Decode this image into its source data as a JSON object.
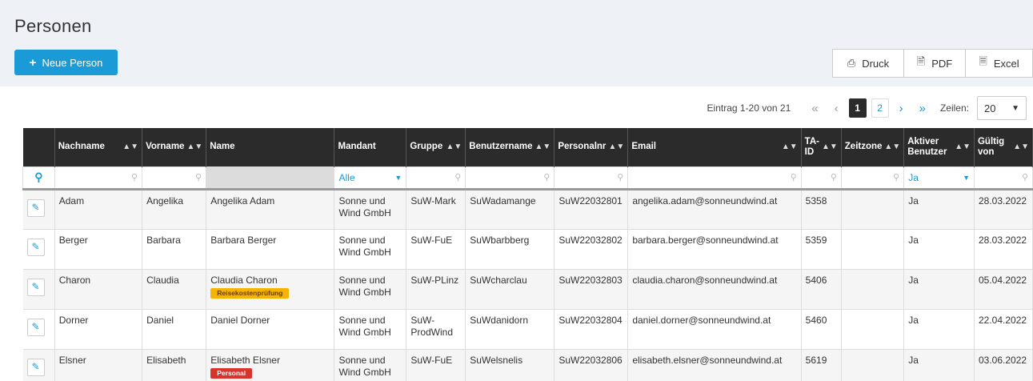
{
  "page": {
    "title": "Personen",
    "new_button": "Neue Person"
  },
  "export": {
    "druck": "Druck",
    "pdf": "PDF",
    "excel": "Excel"
  },
  "pager": {
    "info": "Eintrag 1-20 von 21",
    "first": "«",
    "prev": "‹",
    "page1": "1",
    "page2": "2",
    "next": "›",
    "last": "»",
    "rows_label": "Zeilen:",
    "rows_value": "20"
  },
  "columns": [
    "Nachname",
    "Vorname",
    "Name",
    "Mandant",
    "Gruppe",
    "Benutzername",
    "Personalnr",
    "Email",
    "TA-ID",
    "Zeitzone",
    "Aktiver Benutzer",
    "Gültig von"
  ],
  "filters": {
    "mandant": "Alle",
    "aktiv": "Ja"
  },
  "rows": [
    {
      "nachname": "Adam",
      "vorname": "Angelika",
      "name": "Angelika Adam",
      "badge": "",
      "badge_color": "",
      "mandant": "Sonne und Wind GmbH",
      "gruppe": "SuW-Mark",
      "benutzer": "SuWadamange",
      "personalnr": "SuW22032801",
      "email": "angelika.adam@sonneundwind.at",
      "taid": "5358",
      "zeitzone": "",
      "aktiv": "Ja",
      "gueltig": "28.03.2022"
    },
    {
      "nachname": "Berger",
      "vorname": "Barbara",
      "name": "Barbara Berger",
      "badge": "",
      "badge_color": "",
      "mandant": "Sonne und Wind GmbH",
      "gruppe": "SuW-FuE",
      "benutzer": "SuWbarbberg",
      "personalnr": "SuW22032802",
      "email": "barbara.berger@sonneundwind.at",
      "taid": "5359",
      "zeitzone": "",
      "aktiv": "Ja",
      "gueltig": "28.03.2022"
    },
    {
      "nachname": "Charon",
      "vorname": "Claudia",
      "name": "Claudia Charon",
      "badge": "Reisekostenprüfung",
      "badge_color": "yellow",
      "mandant": "Sonne und Wind GmbH",
      "gruppe": "SuW-PLinz",
      "benutzer": "SuWcharclau",
      "personalnr": "SuW22032803",
      "email": "claudia.charon@sonneundwind.at",
      "taid": "5406",
      "zeitzone": "",
      "aktiv": "Ja",
      "gueltig": "05.04.2022"
    },
    {
      "nachname": "Dorner",
      "vorname": "Daniel",
      "name": "Daniel Dorner",
      "badge": "",
      "badge_color": "",
      "mandant": "Sonne und Wind GmbH",
      "gruppe": "SuW-ProdWind",
      "benutzer": "SuWdanidorn",
      "personalnr": "SuW22032804",
      "email": "daniel.dorner@sonneundwind.at",
      "taid": "5460",
      "zeitzone": "",
      "aktiv": "Ja",
      "gueltig": "22.04.2022"
    },
    {
      "nachname": "Elsner",
      "vorname": "Elisabeth",
      "name": "Elisabeth Elsner",
      "badge": "Personal",
      "badge_color": "red",
      "mandant": "Sonne und Wind GmbH",
      "gruppe": "SuW-FuE",
      "benutzer": "SuWelsnelis",
      "personalnr": "SuW22032806",
      "email": "elisabeth.elsner@sonneundwind.at",
      "taid": "5619",
      "zeitzone": "",
      "aktiv": "Ja",
      "gueltig": "03.06.2022"
    }
  ],
  "colors": {
    "accent": "#1a9ad6",
    "header_dark": "#2b2b2b",
    "badge_yellow": "#f5b400",
    "badge_red": "#d9342b"
  },
  "icons": {
    "new": "plus-icon",
    "druck": "printer-icon",
    "pdf": "pdf-file-icon",
    "excel": "excel-file-icon",
    "search": "search-icon",
    "edit": "pencil-icon",
    "sort": "sort-icon"
  }
}
